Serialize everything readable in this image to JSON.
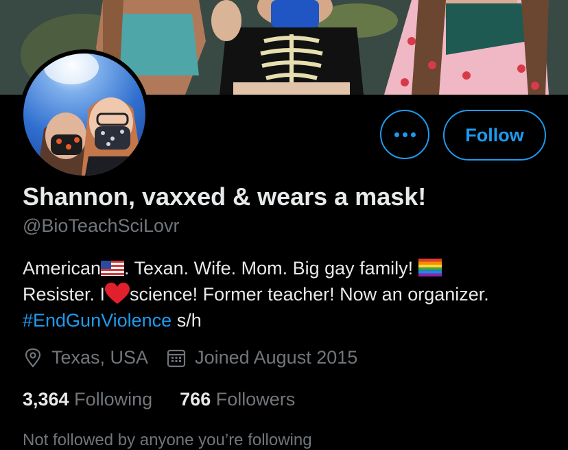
{
  "profile": {
    "display_name": "Shannon, vaxxed & wears a mask!",
    "handle": "@BioTeachSciLovr",
    "bio": {
      "line1_a": "American",
      "line1_b": ". Texan. Wife. Mom. Big gay family!",
      "line2_a": "Resister. I",
      "line2_b": "science! Former teacher! Now an organizer.",
      "hashtag": "#EndGunViolence",
      "line3_rest": " s/h"
    },
    "location": "Texas, USA",
    "joined": "Joined August 2015",
    "following_count": "3,364",
    "following_label": "Following",
    "followers_count": "766",
    "followers_label": "Followers",
    "notice": "Not followed by anyone you’re following"
  },
  "actions": {
    "follow_label": "Follow"
  },
  "icons": {
    "more": "more-horizontal-icon",
    "location": "location-pin-icon",
    "calendar": "calendar-icon"
  },
  "colors": {
    "accent": "#1d9bf0",
    "background": "#000000",
    "secondary_text": "#71767b"
  }
}
